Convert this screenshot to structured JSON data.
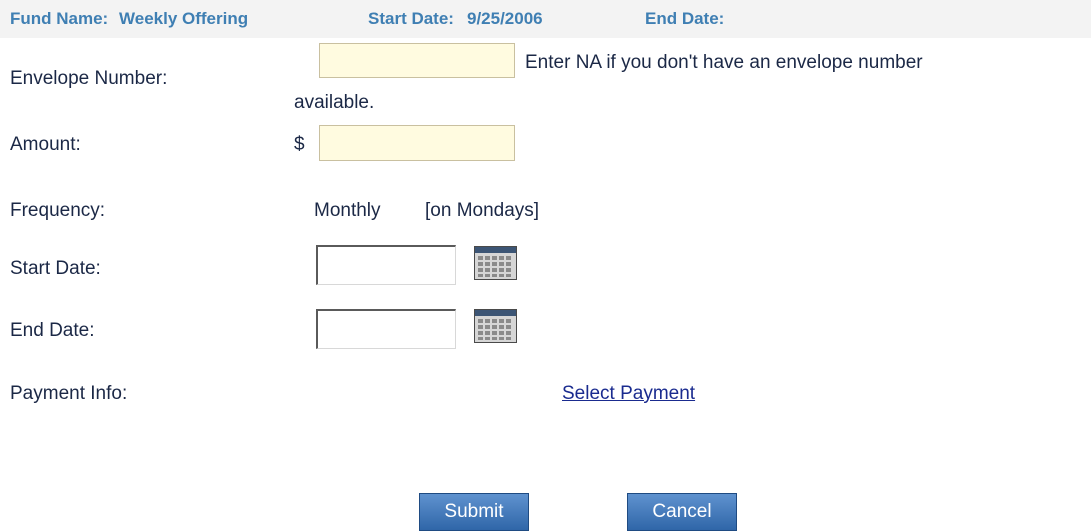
{
  "header": {
    "fund_name_label": "Fund Name:",
    "fund_name_value": "Weekly Offering",
    "start_date_label": "Start Date:",
    "start_date_value": "9/25/2006",
    "end_date_label": "End Date:",
    "end_date_value": ""
  },
  "form": {
    "envelope": {
      "label": "Envelope Number:",
      "value": "",
      "hint_line1": "Enter NA if you don't have an envelope number",
      "hint_line2": "available."
    },
    "amount": {
      "label": "Amount:",
      "currency_symbol": "$",
      "value": ""
    },
    "frequency": {
      "label": "Frequency:",
      "value": "Monthly",
      "detail": "[on Mondays]"
    },
    "start_date": {
      "label": "Start Date:",
      "value": "",
      "icon": "calendar-icon"
    },
    "end_date": {
      "label": "End Date:",
      "value": "",
      "icon": "calendar-icon"
    },
    "payment": {
      "label": "Payment Info:",
      "link_text": "Select Payment"
    }
  },
  "actions": {
    "submit_label": "Submit",
    "cancel_label": "Cancel"
  },
  "colors": {
    "header_text": "#3f7fb3",
    "header_background": "#f3f3f3",
    "label_text": "#1b2846",
    "link": "#1a2b8f",
    "button_top": "#5f92cf",
    "button_bottom": "#2f66a8",
    "input_yellow": "#fffbe0"
  }
}
